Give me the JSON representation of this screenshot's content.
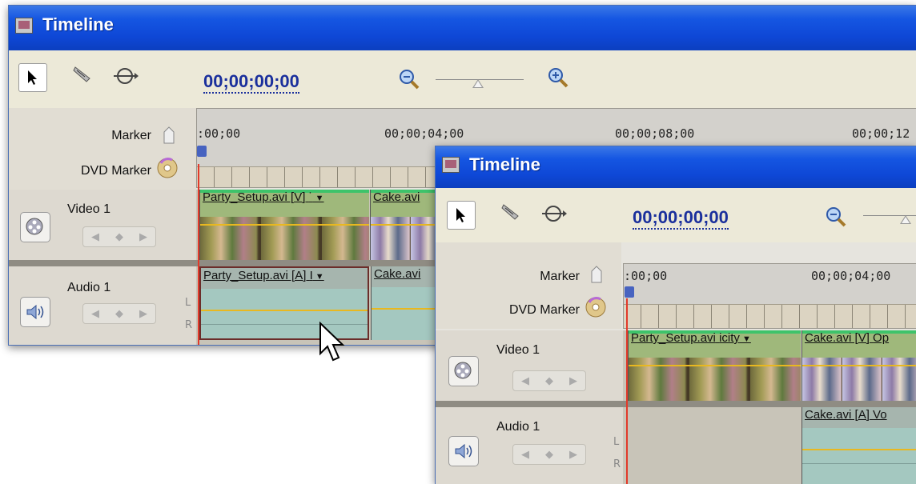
{
  "window_back": {
    "title": "Timeline",
    "timecode": "00;00;00;00",
    "marker_label": "Marker",
    "dvd_marker_label": "DVD Marker",
    "ruler_ticks": [
      ":00;00",
      "00;00;04;00",
      "00;00;08;00",
      "00;00;12"
    ],
    "video_track": {
      "name": "Video 1",
      "clips": [
        {
          "name": "Party_Setup.avi [V]",
          "suffix": "˙"
        },
        {
          "name": "Cake.avi"
        }
      ]
    },
    "audio_track": {
      "name": "Audio 1",
      "clips": [
        {
          "name": "Party_Setup.avi [A]",
          "suffix": "I"
        },
        {
          "name": "Cake.avi"
        }
      ],
      "channel_l": "L",
      "channel_r": "R"
    }
  },
  "window_front": {
    "title": "Timeline",
    "timecode": "00;00;00;00",
    "marker_label": "Marker",
    "dvd_marker_label": "DVD Marker",
    "ruler_ticks": [
      ":00;00",
      "00;00;04;00"
    ],
    "video_track": {
      "name": "Video 1",
      "clips": [
        {
          "name": "Party_Setup.avi",
          "suffix": "icity"
        },
        {
          "name": "Cake.avi [V]",
          "suffix": "Op"
        }
      ]
    },
    "audio_track": {
      "name": "Audio 1",
      "clips": [
        {
          "name": "Cake.avi [A]",
          "suffix": "Vo"
        }
      ],
      "channel_l": "L",
      "channel_r": "R"
    }
  },
  "icons": {
    "selection_tool": "arrow-cursor-icon",
    "razor_tool": "razor-icon",
    "track_select_tool": "track-select-icon",
    "zoom_out": "zoom-out-icon",
    "zoom_in": "zoom-in-icon",
    "marker": "marker-icon",
    "dvd_marker": "dvd-icon",
    "video_toggle": "film-reel-icon",
    "audio_toggle": "speaker-icon"
  },
  "colors": {
    "title_bar": "#0e47d6",
    "timecode": "#1a2f9c",
    "playhead": "#e23a2a",
    "video_clip_bar": "#3ec36a",
    "rubber_band": "#e8b820"
  }
}
